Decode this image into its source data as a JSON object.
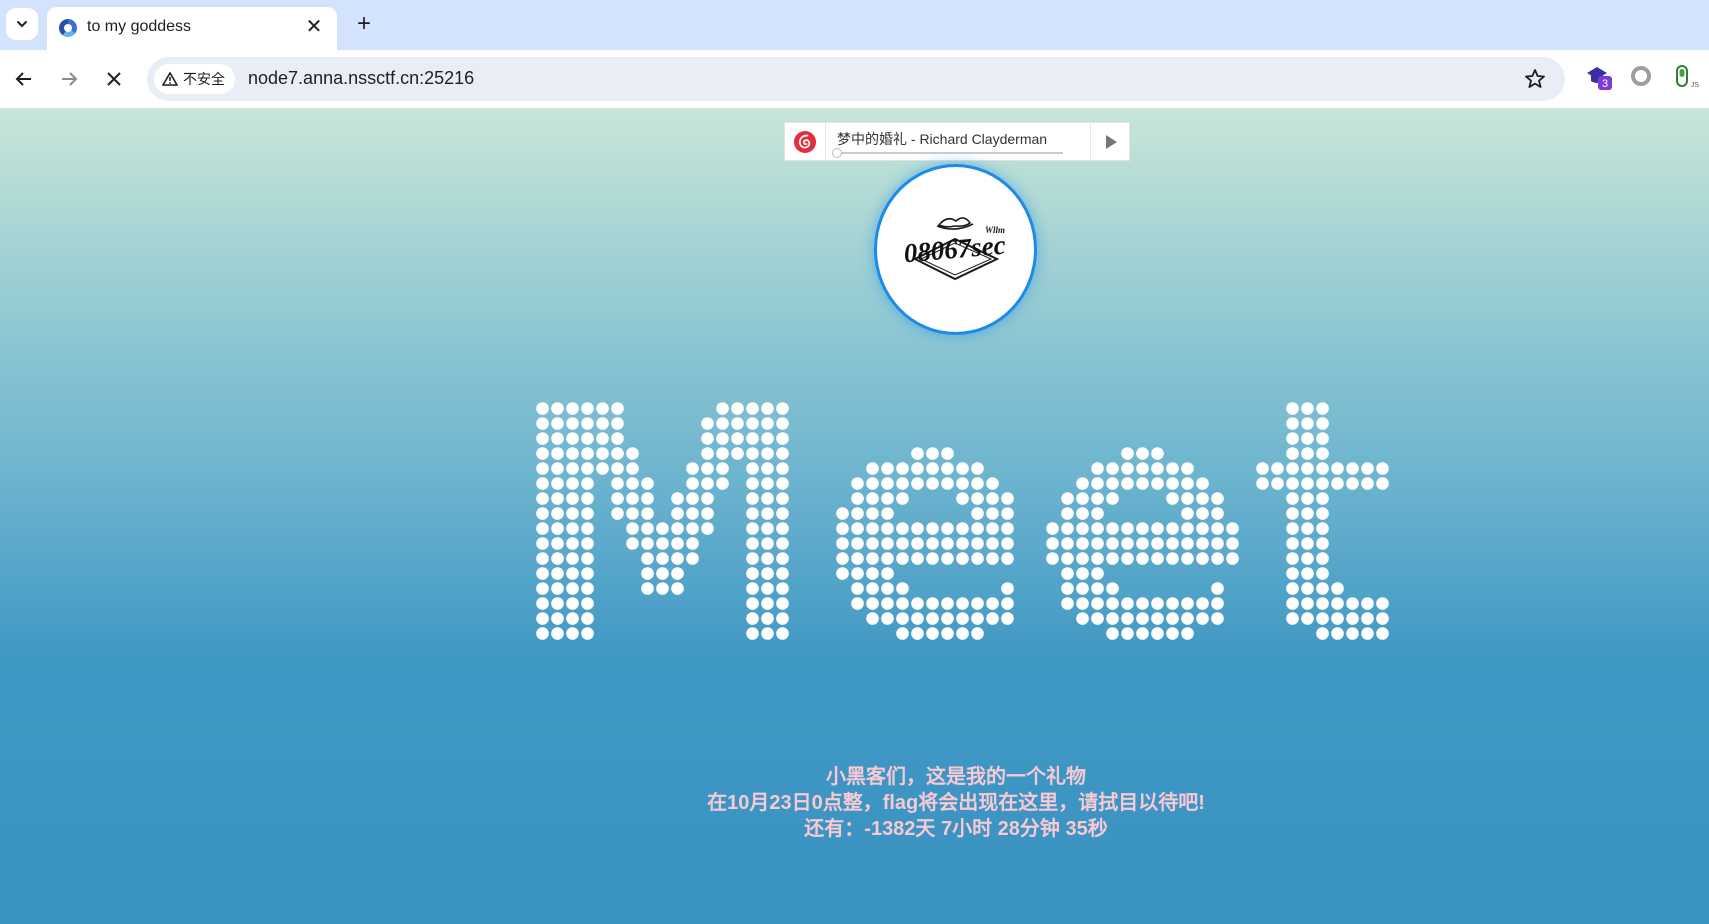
{
  "browser": {
    "tab": {
      "title": "to my goddess"
    },
    "security_chip": "不安全",
    "url": "node7.anna.nssctf.cn:25216",
    "extension_badge": "3"
  },
  "player": {
    "song": "梦中的婚礼 - Richard Clayderman",
    "progress": 0
  },
  "avatar": {
    "logo_text": "08067sec",
    "logo_small": "Wllm"
  },
  "headline": "Meet",
  "message": {
    "line1": "小黑客们，这是我的一个礼物",
    "line2": "在10月23日0点整，flag将会出现在这里，请拭目以待吧!",
    "line3": "还有：-1382天 7小时 28分钟 35秒"
  },
  "colors": {
    "accent": "#1a8be8",
    "caption": "#f6c9d4",
    "player_logo": "#e02e3a"
  }
}
